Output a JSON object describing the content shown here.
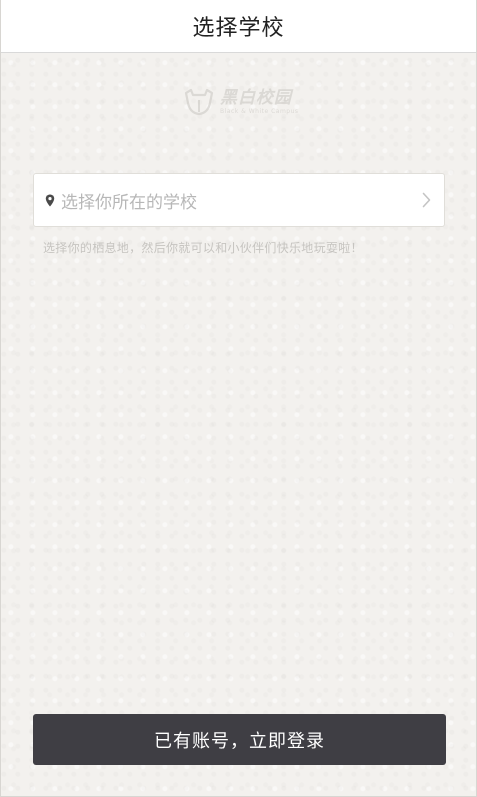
{
  "header": {
    "title": "选择学校"
  },
  "logo": {
    "name": "黑白校园",
    "tagline": "Black & White Campus"
  },
  "school_select": {
    "placeholder": "选择你所在的学校",
    "leading_icon": "location-pin-icon",
    "trailing_icon": "chevron-right-icon"
  },
  "hint": {
    "text": "选择你的栖息地，然后你就可以和小伙伴们快乐地玩耍啦！"
  },
  "login_button": {
    "label": "已有账号，立即登录"
  },
  "colors": {
    "background": "#f3f1ee",
    "header_bg": "#ffffff",
    "button_bg": "#3f3e44",
    "button_text": "#ffffff",
    "placeholder_text": "#b7b7b7",
    "hint_text": "#c6c4c0"
  }
}
